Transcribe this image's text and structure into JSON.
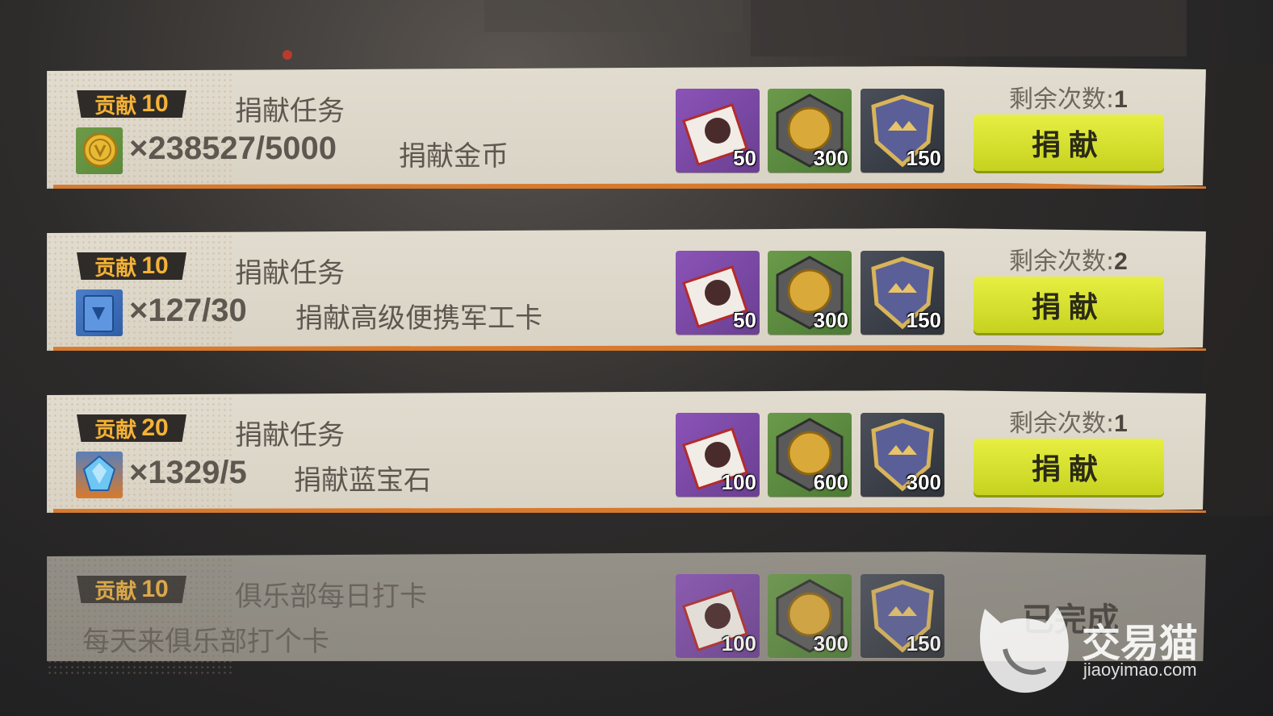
{
  "tasks": [
    {
      "badge_label": "贡献",
      "badge_value": "10",
      "title": "捐献任务",
      "item_icon": "gold-coin-icon",
      "count": "×238527/5000",
      "desc": "捐献金币",
      "rewards": [
        "50",
        "300",
        "150"
      ],
      "remain_label": "剩余次数:",
      "remain_value": "1",
      "button_label": "捐献"
    },
    {
      "badge_label": "贡献",
      "badge_value": "10",
      "title": "捐献任务",
      "item_icon": "military-card-icon",
      "count": "×127/30",
      "desc": "捐献高级便携军工卡",
      "rewards": [
        "50",
        "300",
        "150"
      ],
      "remain_label": "剩余次数:",
      "remain_value": "2",
      "button_label": "捐献"
    },
    {
      "badge_label": "贡献",
      "badge_value": "20",
      "title": "捐献任务",
      "item_icon": "sapphire-icon",
      "count": "×1329/5",
      "desc": "捐献蓝宝石",
      "rewards": [
        "100",
        "600",
        "300"
      ],
      "remain_label": "剩余次数:",
      "remain_value": "1",
      "button_label": "捐献"
    },
    {
      "badge_label": "贡献",
      "badge_value": "10",
      "title": "俱乐部每日打卡",
      "desc": "每天来俱乐部打个卡",
      "rewards": [
        "100",
        "300",
        "150"
      ],
      "status": "已完成"
    }
  ],
  "reward_icons": [
    "ticket-icon",
    "golden-fist-icon",
    "crown-shield-icon"
  ],
  "watermark": {
    "name": "交易猫",
    "url": "jiaoyimao.com"
  },
  "colors": {
    "accent_orange": "#d77a2e",
    "button_yellow": "#d8e02e",
    "badge_gold": "#f4b236"
  }
}
